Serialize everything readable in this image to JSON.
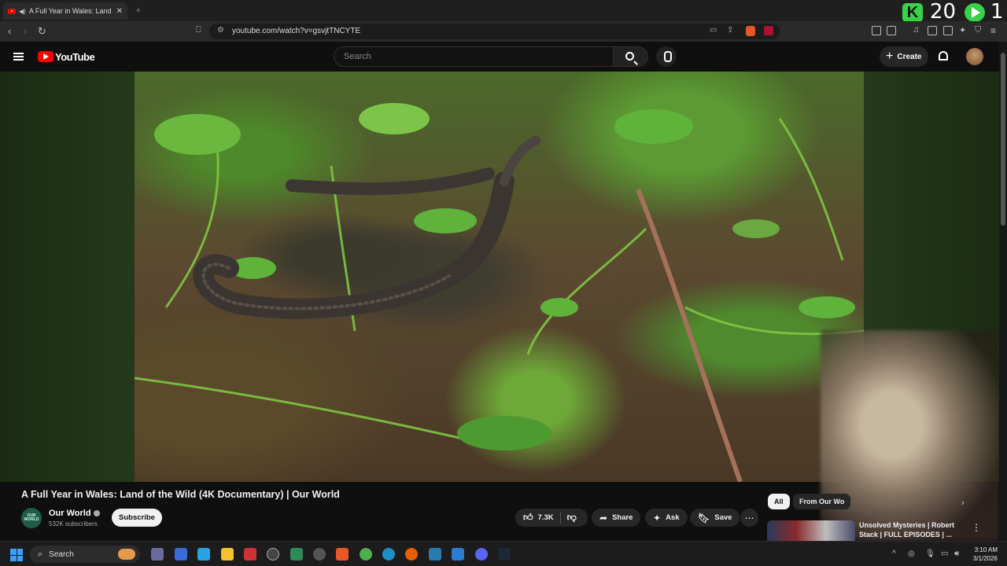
{
  "browser": {
    "tab_title": "A Full Year in Wales: Land of t",
    "url": "youtube.com/watch?v=gsvjtTNCYTE",
    "new_tab_glyph": "+"
  },
  "overlay": {
    "kick_glyph": "K",
    "left_count": "20",
    "right_count": "1"
  },
  "youtube": {
    "logo_text": "YouTube",
    "search_placeholder": "Search",
    "create_label": "Create"
  },
  "video": {
    "title": "A Full Year in Wales: Land of the Wild (4K Documentary) | Our World",
    "channel_avatar_text": "OUR WORLD",
    "channel_name": "Our World",
    "subscribers": "532K subscribers",
    "subscribe_label": "Subscribe",
    "likes": "7.3K",
    "share_label": "Share",
    "ask_label": "Ask",
    "save_label": "Save"
  },
  "sidebar": {
    "chips": [
      {
        "label": "All",
        "active": true
      },
      {
        "label": "From Our Wo",
        "active": false
      }
    ],
    "recommendation": {
      "title": "Unsolved Mysteries | Robert Stack | FULL EPISODES | ..."
    }
  },
  "taskbar": {
    "search_label": "Search",
    "time": "3:10 AM",
    "date": "3/1/2026"
  },
  "colors": {
    "youtube_red": "#ff0000",
    "kick_green": "#38d14a",
    "windows_blue": "#3aa0ff"
  },
  "icons": [
    "back-icon",
    "forward-icon",
    "reload-icon",
    "bookmark-icon",
    "hamburger-icon",
    "search-icon",
    "mic-icon",
    "bell-icon",
    "like-icon",
    "dislike-icon",
    "share-icon",
    "ask-icon",
    "save-icon",
    "more-icon",
    "windows-icon"
  ]
}
